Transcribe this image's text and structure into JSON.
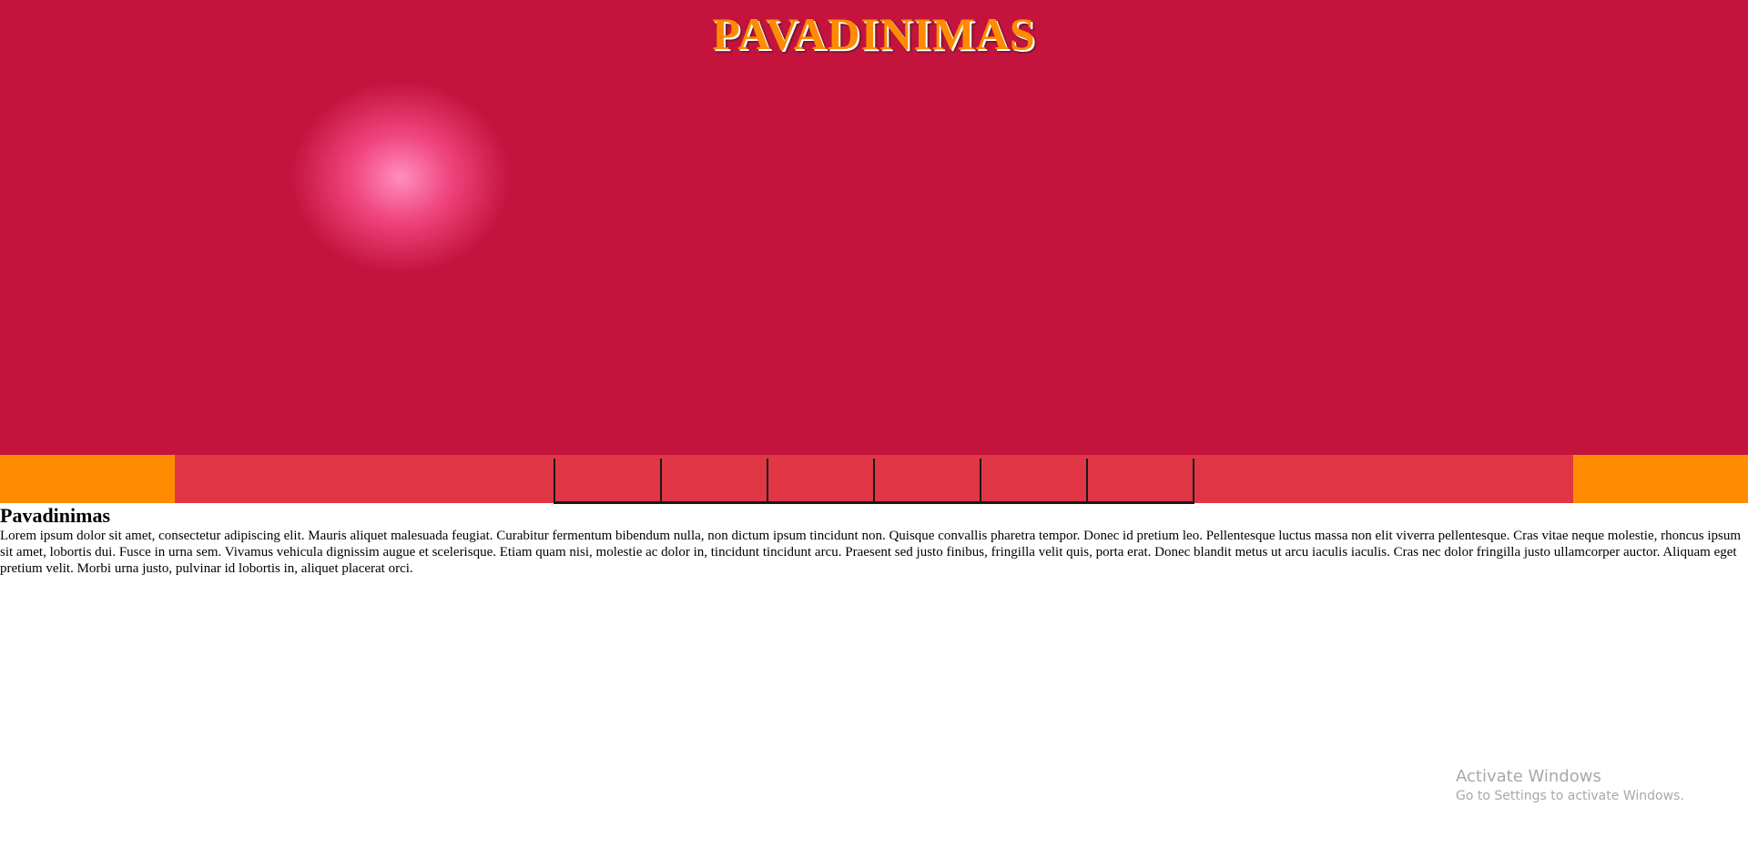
{
  "header": {
    "title": "PAVADINIMAS"
  },
  "nav": {
    "items": [
      {
        "label": ""
      },
      {
        "label": ""
      },
      {
        "label": ""
      },
      {
        "label": ""
      },
      {
        "label": ""
      },
      {
        "label": ""
      }
    ]
  },
  "article": {
    "heading": "Pavadinimas",
    "body": "Lorem ipsum dolor sit amet, consectetur adipiscing elit. Mauris aliquet malesuada feugiat. Curabitur fermentum bibendum nulla, non dictum ipsum tincidunt non. Quisque convallis pharetra tempor. Donec id pretium leo. Pellentesque luctus massa non elit viverra pellentesque. Cras vitae neque molestie, rhoncus ipsum sit amet, lobortis dui. Fusce in urna sem. Vivamus vehicula dignissim augue et scelerisque. Etiam quam nisi, molestie ac dolor in, tincidunt tincidunt arcu. Praesent sed justo finibus, fringilla velit quis, porta erat. Donec blandit metus ut arcu iaculis iaculis. Cras nec dolor fringilla justo ullamcorper auctor. Aliquam eget pretium velit. Morbi urna justo, pulvinar id lobortis in, aliquet placerat orci."
  },
  "watermark": {
    "title": "Activate Windows",
    "subtitle": "Go to Settings to activate Windows."
  },
  "colors": {
    "title": "#ff8c00",
    "nav_outer": "#ff8c00",
    "nav_inner": "#e03645",
    "nav_border": "#1a1a1a"
  },
  "icons": {
    "hero": "roses-banner-image"
  }
}
